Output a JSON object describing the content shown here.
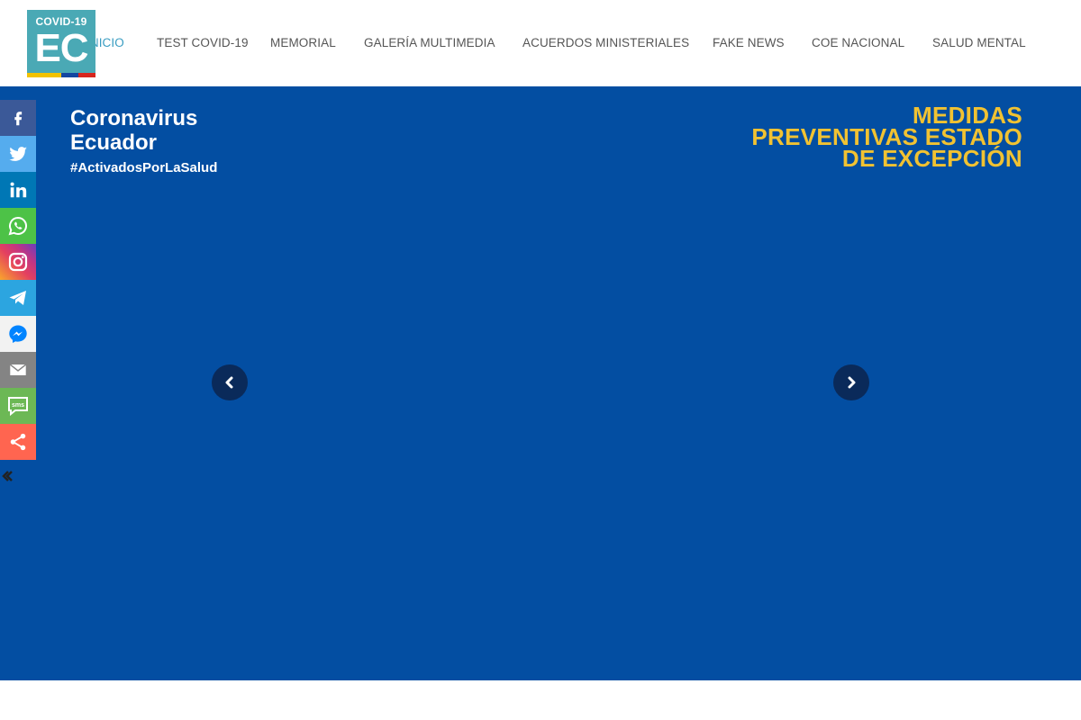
{
  "logo": {
    "line1": "COVID-19",
    "line2": "EC"
  },
  "nav": {
    "items": [
      {
        "label": "Inicio",
        "active": true
      },
      {
        "label": "Test COVID-19"
      },
      {
        "label": "Memorial"
      },
      {
        "label": "Galería Multimedia"
      },
      {
        "label": "Acuerdos Ministeriales"
      },
      {
        "label": "Fake News"
      },
      {
        "label": "COE Nacional"
      },
      {
        "label": "Salud Mental"
      }
    ]
  },
  "hero": {
    "brand_line1": "Coronavirus",
    "brand_line2": "Ecuador",
    "hashtag": "#ActivadosPorLaSalud",
    "title_line1": "MEDIDAS",
    "title_line2": "PREVENTIVAS ESTADO",
    "title_line3": "DE EXCEPCIÓN",
    "prev_icon": "chevron-left-icon",
    "next_icon": "chevron-right-icon"
  },
  "share": {
    "buttons": [
      {
        "name": "facebook",
        "color": "#3b5998"
      },
      {
        "name": "twitter",
        "color": "#55acee"
      },
      {
        "name": "linkedin",
        "color": "#0077b5"
      },
      {
        "name": "whatsapp",
        "color": "#4dc247"
      },
      {
        "name": "instagram",
        "color": "#c13584"
      },
      {
        "name": "telegram",
        "color": "#2ca5e0"
      },
      {
        "name": "messenger",
        "color": "#f2f2f2"
      },
      {
        "name": "email",
        "color": "#848484"
      },
      {
        "name": "sms",
        "color": "#6cb855"
      },
      {
        "name": "more",
        "color": "#ff6550"
      }
    ]
  },
  "colors": {
    "hero_bg": "#034ea2",
    "accent_yellow": "#f1c232",
    "nav_active": "#3a9dc2",
    "logo_bg": "#4aa9b5"
  }
}
